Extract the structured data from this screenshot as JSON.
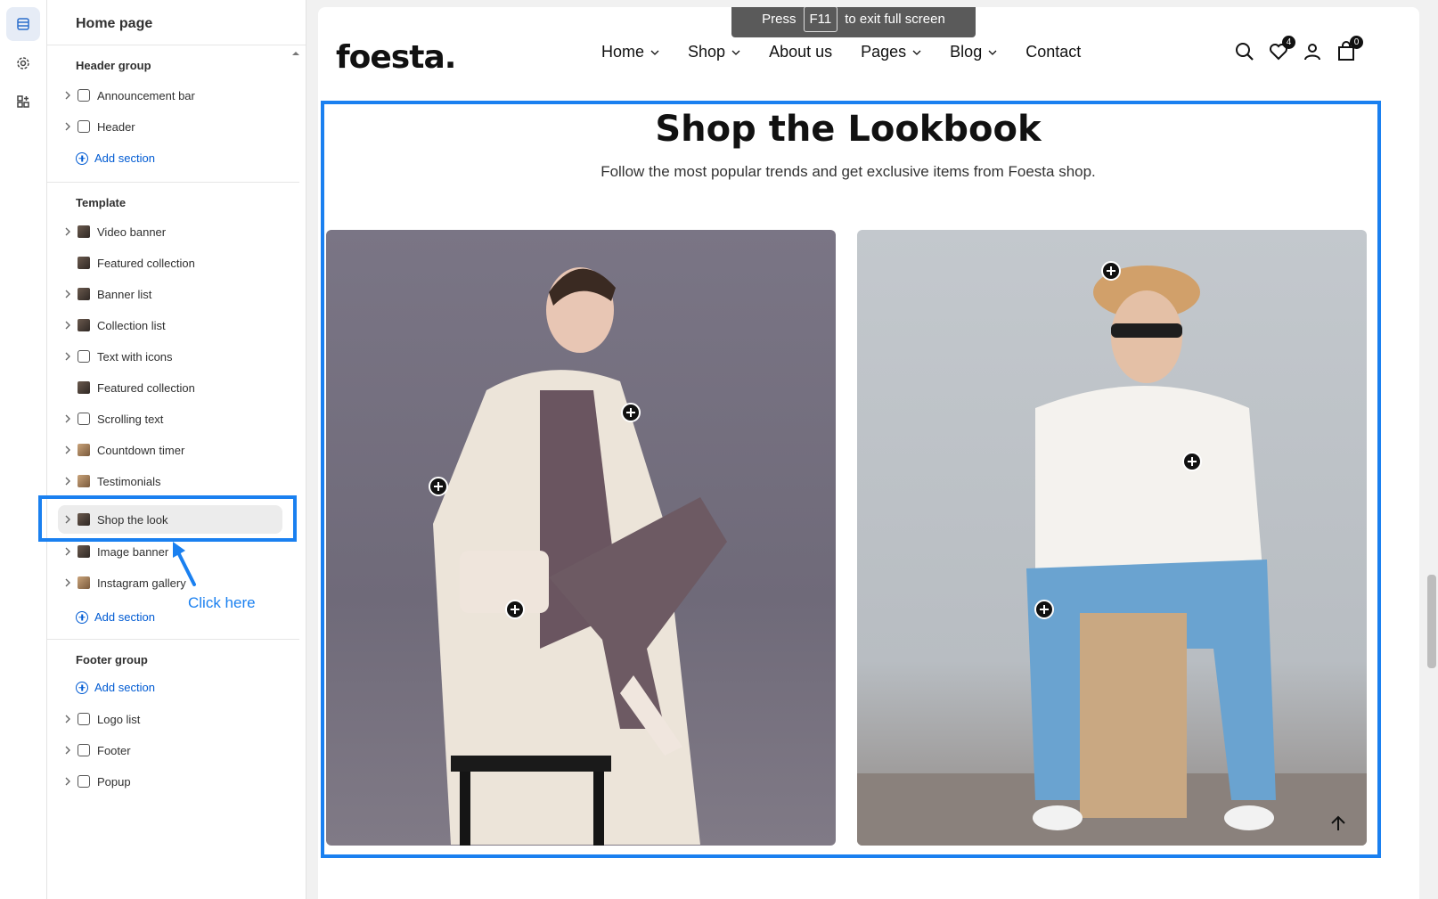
{
  "sidebar": {
    "title": "Home page",
    "header_group": {
      "label": "Header group",
      "items": [
        {
          "label": "Announcement bar"
        },
        {
          "label": "Header"
        }
      ],
      "add_label": "Add section"
    },
    "template": {
      "label": "Template",
      "items": [
        {
          "label": "Video banner"
        },
        {
          "label": "Featured collection"
        },
        {
          "label": "Banner list"
        },
        {
          "label": "Collection list"
        },
        {
          "label": "Text with icons"
        },
        {
          "label": "Featured collection"
        },
        {
          "label": "Scrolling text"
        },
        {
          "label": "Countdown timer"
        },
        {
          "label": "Testimonials"
        },
        {
          "label": "Shop the look"
        },
        {
          "label": "Image banner"
        },
        {
          "label": "Instagram gallery"
        }
      ],
      "add_label": "Add section"
    },
    "footer_group": {
      "label": "Footer group",
      "add_label": "Add section",
      "items": [
        {
          "label": "Logo list"
        },
        {
          "label": "Footer"
        },
        {
          "label": "Popup"
        }
      ]
    }
  },
  "annotation": {
    "click_here": "Click here",
    "color": "#1a80f0"
  },
  "fullscreen_hint": {
    "press": "Press",
    "key": "F11",
    "rest": "to exit full screen"
  },
  "store": {
    "logo": "foesta.",
    "nav": [
      {
        "label": "Home",
        "dropdown": true
      },
      {
        "label": "Shop",
        "dropdown": true
      },
      {
        "label": "About us",
        "dropdown": false
      },
      {
        "label": "Pages",
        "dropdown": true
      },
      {
        "label": "Blog",
        "dropdown": true
      },
      {
        "label": "Contact",
        "dropdown": false
      }
    ],
    "wishlist_count": "4",
    "cart_count": "0",
    "lookbook": {
      "title": "Shop the Lookbook",
      "subtitle": "Follow the most popular trends and get exclusive items from Foesta shop."
    }
  }
}
